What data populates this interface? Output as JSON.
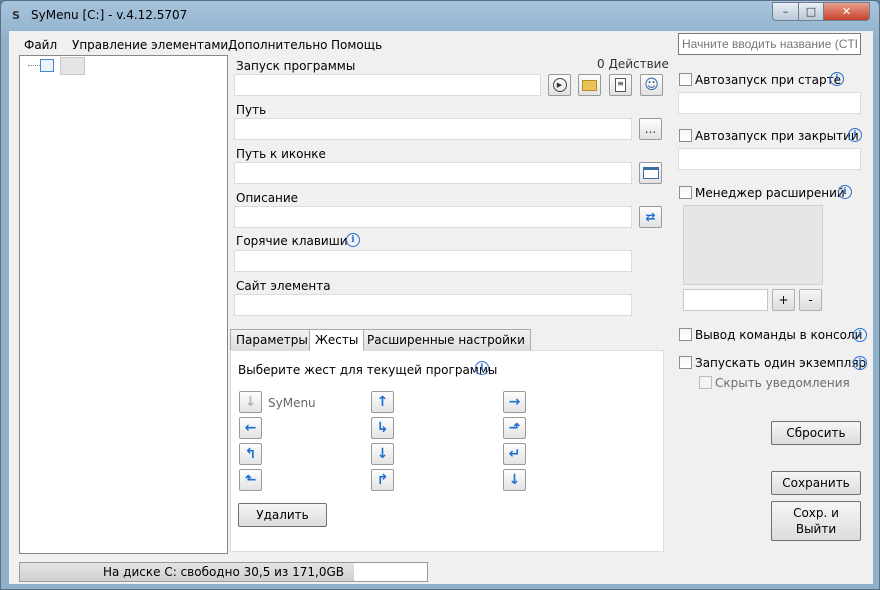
{
  "window": {
    "title": "SyMenu [C:] - v.4.12.5707",
    "app_icon": "S",
    "min_glyph": "–",
    "max_glyph": "□",
    "close_glyph": "✕"
  },
  "menu": [
    "Файл",
    "Управление элементами",
    "Дополнительно",
    "Помощь"
  ],
  "search": {
    "placeholder": "Начните вводить название (CTRL"
  },
  "form": {
    "launch_label": "Запуск программы",
    "action_count": "0 Действие",
    "path_label": "Путь",
    "path_browse": "...",
    "icon_path_label": "Путь к иконке",
    "description_label": "Описание",
    "hotkeys_label": "Горячие клавиши",
    "site_label": "Сайт элемента"
  },
  "tabs": [
    "Параметры",
    "Жесты",
    "Расширенные настройки"
  ],
  "gestures": {
    "prompt": "Выберите жест для текущей программы",
    "current": "SyMenu",
    "delete_label": "Удалить"
  },
  "options": {
    "autostart_start": "Автозапуск при старте",
    "autostart_close": "Автозапуск при закрытии",
    "extension_manager": "Менеджер расширений",
    "plus": "+",
    "minus": "-",
    "console_output": "Вывод команды в консоли",
    "single_instance": "Запускать один экземпляр",
    "hide_notifications": "Скрыть уведомления"
  },
  "buttons": {
    "reset": "Сбросить",
    "save": "Сохранить",
    "save_exit": "Сохр. и Выйти"
  },
  "status": {
    "disk_text": "На диске C: свободно 30,5 из 171,0GB",
    "disk_used_fraction": 0.82
  },
  "info_glyph": "i",
  "icons": {
    "play": "▶",
    "folder": "▬",
    "doc": "≡",
    "user": "☺",
    "swap": "⇄",
    "window": "▭"
  }
}
